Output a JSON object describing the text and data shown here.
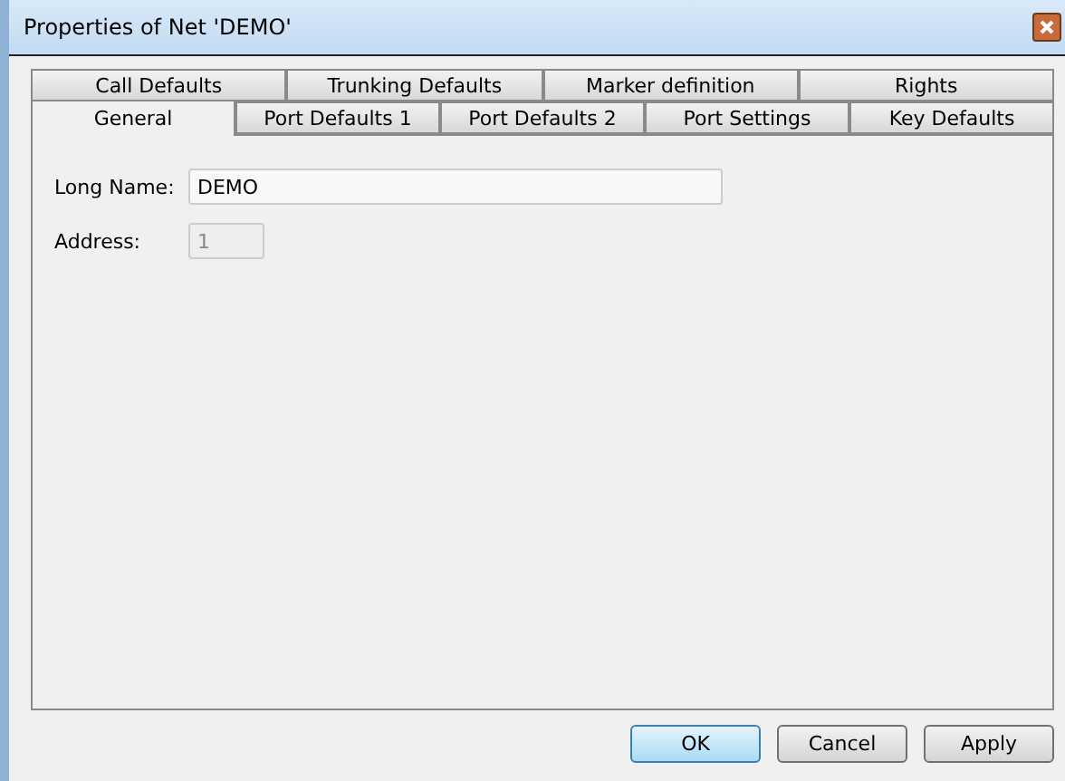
{
  "window": {
    "title": "Properties of Net 'DEMO'"
  },
  "tab_rows": [
    [
      {
        "label": "Call Defaults",
        "selected": false
      },
      {
        "label": "Trunking Defaults",
        "selected": false
      },
      {
        "label": "Marker definition",
        "selected": false
      },
      {
        "label": "Rights",
        "selected": false
      }
    ],
    [
      {
        "label": "General",
        "selected": true
      },
      {
        "label": "Port Defaults 1",
        "selected": false
      },
      {
        "label": "Port Defaults 2",
        "selected": false
      },
      {
        "label": "Port Settings",
        "selected": false
      },
      {
        "label": "Key Defaults",
        "selected": false
      }
    ]
  ],
  "fields": [
    {
      "label": "Long Name:",
      "value": "DEMO",
      "disabled": false
    },
    {
      "label": "Address:",
      "value": "1",
      "disabled": true
    }
  ],
  "buttons": [
    {
      "label": "OK",
      "default": true
    },
    {
      "label": "Cancel",
      "default": false
    },
    {
      "label": "Apply",
      "default": false
    }
  ]
}
